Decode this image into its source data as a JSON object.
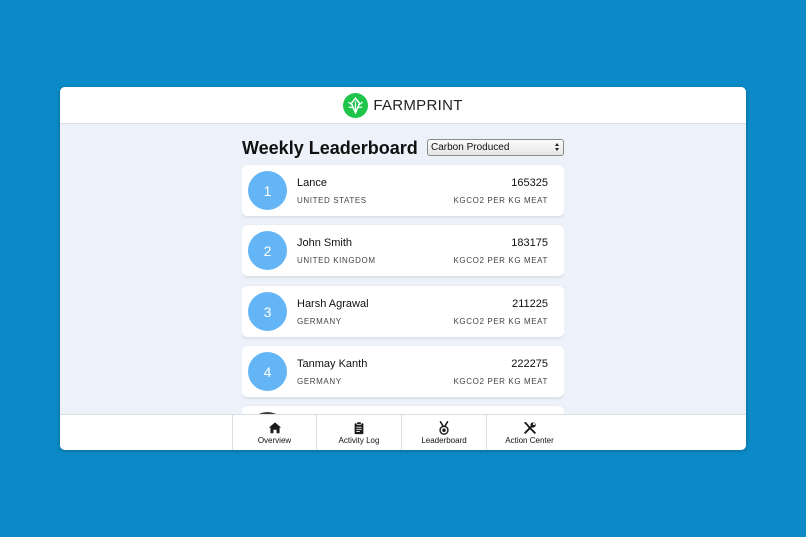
{
  "app": {
    "brand": "FARMPRINT",
    "brand_color": "#1fc44a",
    "background_color": "#0b8ac7",
    "logo_icon": "leaf-logo-icon"
  },
  "leaderboard": {
    "title": "Weekly Leaderboard",
    "metric_select": {
      "selected": "Carbon Produced"
    },
    "rank_color": "#64b5f6",
    "entries": [
      {
        "rank": "1",
        "name": "Lance",
        "country": "UNITED STATES",
        "value": "165325",
        "unit": "KGCO2 PER KG MEAT"
      },
      {
        "rank": "2",
        "name": "John Smith",
        "country": "UNITED KINGDOM",
        "value": "183175",
        "unit": "KGCO2 PER KG MEAT"
      },
      {
        "rank": "3",
        "name": "Harsh Agrawal",
        "country": "GERMANY",
        "value": "211225",
        "unit": "KGCO2 PER KG MEAT"
      },
      {
        "rank": "4",
        "name": "Tanmay Kanth",
        "country": "GERMANY",
        "value": "222275",
        "unit": "KGCO2 PER KG MEAT"
      }
    ]
  },
  "bottom_nav": {
    "items": [
      {
        "label": "Overview",
        "icon": "home-icon"
      },
      {
        "label": "Activity Log",
        "icon": "clipboard-icon"
      },
      {
        "label": "Leaderboard",
        "icon": "medal-icon"
      },
      {
        "label": "Action Center",
        "icon": "tools-icon"
      }
    ]
  }
}
